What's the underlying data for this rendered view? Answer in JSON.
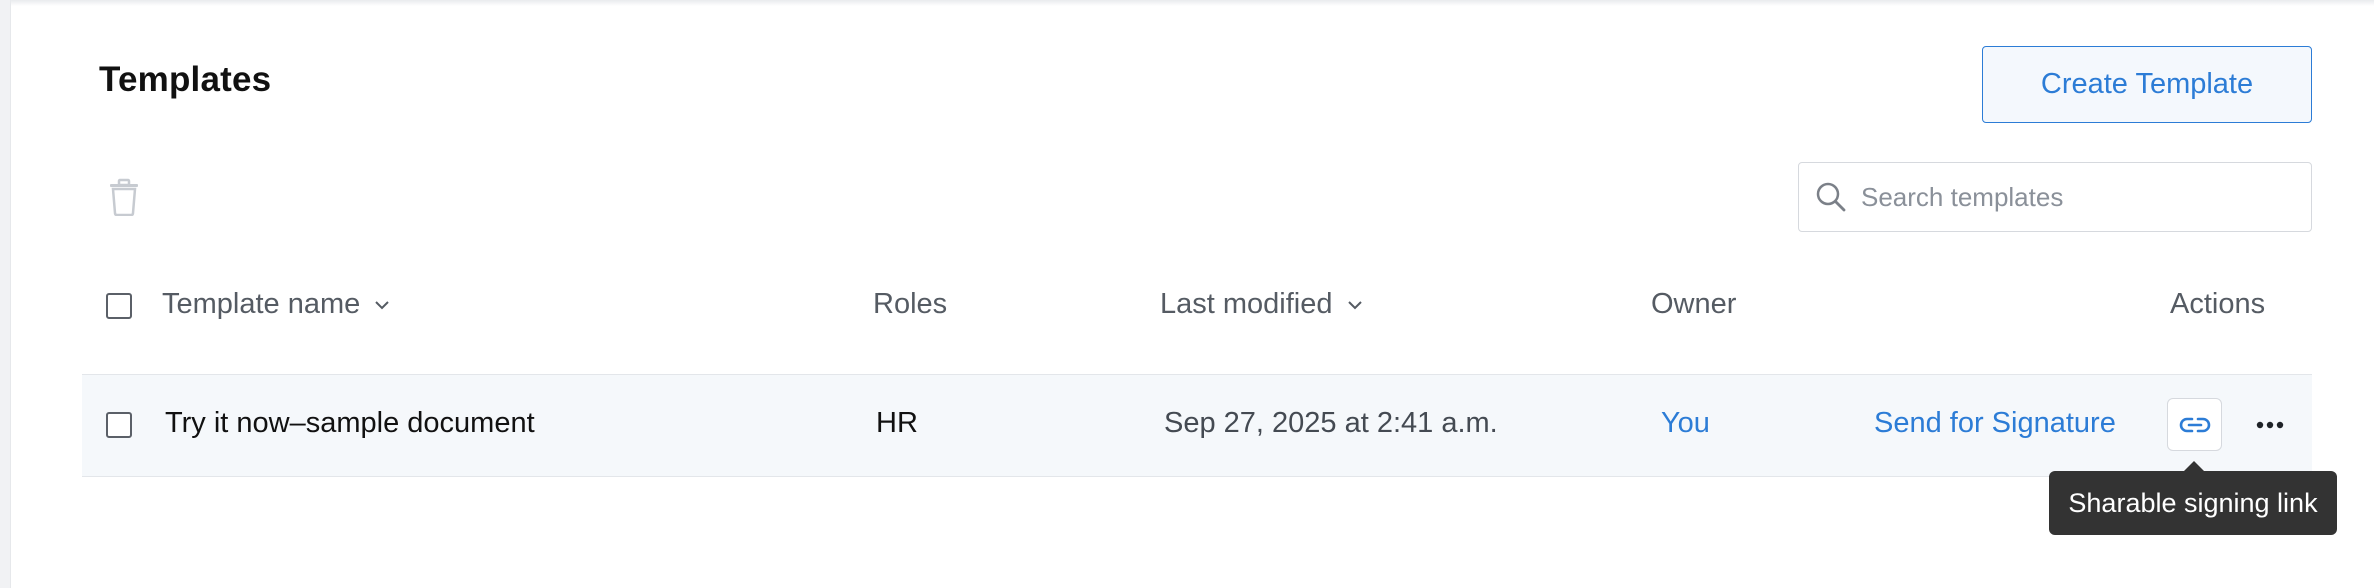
{
  "header": {
    "title": "Templates",
    "create_button_label": "Create Template"
  },
  "toolbar": {
    "delete_icon": "trash-icon",
    "search": {
      "placeholder": "Search templates",
      "value": "",
      "icon": "search-icon"
    }
  },
  "table": {
    "columns": [
      {
        "label": "Template name",
        "sortable": true
      },
      {
        "label": "Roles",
        "sortable": false
      },
      {
        "label": "Last modified",
        "sortable": true
      },
      {
        "label": "Owner",
        "sortable": false
      },
      {
        "label": "Actions",
        "sortable": false
      }
    ],
    "rows": [
      {
        "name": "Try it now–sample document",
        "roles": "HR",
        "last_modified": "Sep 27, 2025 at 2:41 a.m.",
        "owner": "You",
        "send_label": "Send for Signature",
        "link_icon": "link-icon",
        "more_icon": "more-horizontal-icon"
      }
    ]
  },
  "tooltip": {
    "text": "Sharable signing link"
  },
  "colors": {
    "accent": "#2c7cd6",
    "row_background": "#f5f8fb",
    "tooltip_background": "#333333"
  }
}
